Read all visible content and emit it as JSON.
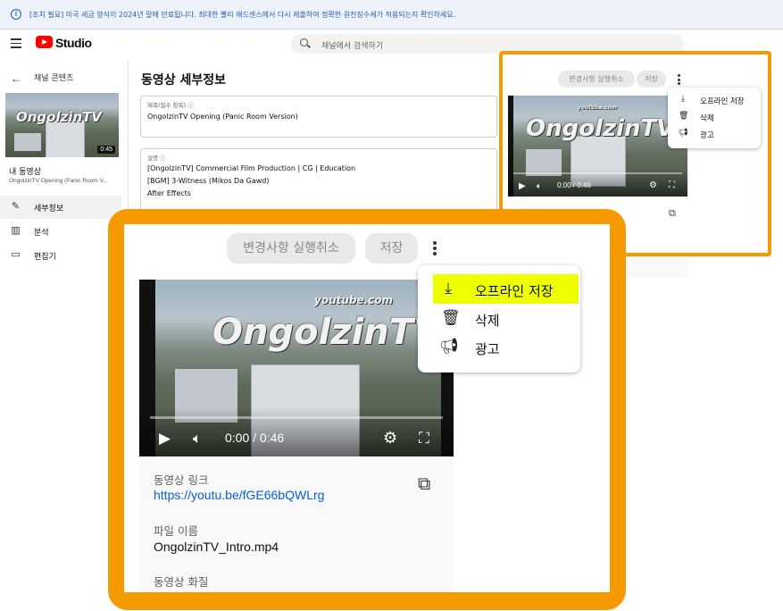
{
  "banner": {
    "text": "[조치 필요] 미국 세금 양식이 2024년 말에 만료됩니다. 최대한 빨리 애드센스에서 다시 제출하여 정확한 원천징수세가 적용되는지 확인하세요."
  },
  "header": {
    "logo_text": "Studio",
    "search_placeholder": "채널에서 검색하기"
  },
  "sidebar": {
    "back_label": "채널 콘텐츠",
    "thumb_duration": "0:45",
    "my_video_label": "내 동영상",
    "video_title": "OngolzinTV Opening (Panic Room V...",
    "items": [
      {
        "label": "세부정보",
        "icon": "pencil-icon",
        "active": true
      },
      {
        "label": "분석",
        "icon": "analytics-icon",
        "active": false
      },
      {
        "label": "편집기",
        "icon": "editor-icon",
        "active": false
      }
    ]
  },
  "main": {
    "page_title": "동영상 세부정보",
    "title_field": {
      "label": "제목(필수 항목)",
      "value": "OngolzinTV Opening (Panic Room Version)"
    },
    "description_field": {
      "label": "설명",
      "lines": [
        "[OngolzinTV] Commercial Film Production |  CG | Education",
        "[BGM] 3-Witness (Mikos Da Gawd)",
        "After Effects"
      ]
    }
  },
  "actions": {
    "undo_label": "변경사항 실행취소",
    "save_label": "저장"
  },
  "more_menu": {
    "items": [
      {
        "label": "오프라인 저장",
        "icon": "download-icon",
        "highlighted": true
      },
      {
        "label": "삭제",
        "icon": "trash-icon",
        "highlighted": false
      },
      {
        "label": "광고",
        "icon": "megaphone-icon",
        "highlighted": false
      }
    ]
  },
  "player": {
    "time": "0:00 / 0:46",
    "watermark_small": "youtube.com",
    "watermark_big": "OngolzinTV"
  },
  "video_info": {
    "link_label": "동영상 링크",
    "link": "https://youtu.be/fGE66bQWLrg",
    "filename_label": "파일 이름",
    "filename": "OngolzinTV_Intro.mp4",
    "quality_label": "동영상 화질"
  },
  "colors": {
    "highlight_frame": "#f59a00",
    "menu_highlight": "#eeff00",
    "link": "#065fd4",
    "brand_red": "#ff0000"
  }
}
